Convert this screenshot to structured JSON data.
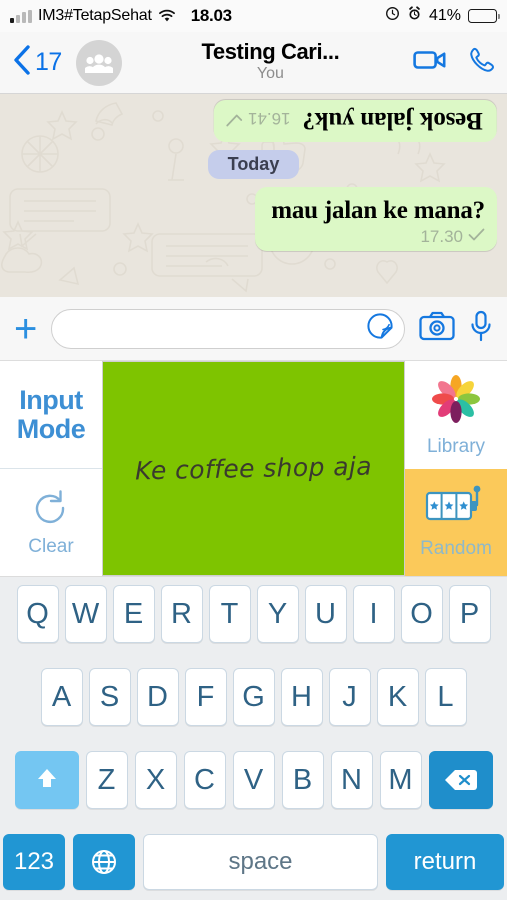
{
  "status_bar": {
    "carrier": "IM3#TetapSehat",
    "wifi_icon": "wifi-icon",
    "time": "18.03",
    "rotation_lock_icon": "rotation-lock-icon",
    "alarm_icon": "alarm-clock-icon",
    "battery_percent": "41%",
    "battery_level": 41
  },
  "navbar": {
    "back_label": "17",
    "back_icon": "chevron-left-icon",
    "avatar_icon": "group-avatar-icon",
    "title": "Testing Cari...",
    "subtitle": "You",
    "video_icon": "video-camera-icon",
    "call_icon": "phone-icon"
  },
  "chat": {
    "messages": [
      {
        "text": "Besok jalan yuk?",
        "time": "16.41",
        "status_icon": "single-check-icon",
        "flipped": true
      },
      {
        "text": "mau jalan ke mana?",
        "time": "17.30",
        "status_icon": "single-check-icon",
        "flipped": false
      }
    ],
    "day_divider": "Today",
    "bubble_color": "#DCF8C6",
    "background_color": "#E9E5DD"
  },
  "input_bar": {
    "plus_icon": "plus-icon",
    "plus_label": "+",
    "field_value": "",
    "field_placeholder": "",
    "sticker_icon": "sticker-icon",
    "camera_icon": "camera-icon",
    "mic_icon": "microphone-icon"
  },
  "handwriting_panel": {
    "input_mode_label": "Input\nMode",
    "input_mode_line1": "Input",
    "input_mode_line2": "Mode",
    "clear_icon": "refresh-icon",
    "clear_label": "Clear",
    "canvas_text": "Ke coffee shop aja",
    "canvas_color": "#7EC400",
    "library_icon": "flower-pinwheel-icon",
    "library_label": "Library",
    "random_icon": "slot-machine-icon",
    "random_label": "Random",
    "random_bg_color": "#FBC95A",
    "accent_color": "#3D8FD4"
  },
  "keyboard": {
    "row1": [
      "Q",
      "W",
      "E",
      "R",
      "T",
      "Y",
      "U",
      "I",
      "O",
      "P"
    ],
    "row2": [
      "A",
      "S",
      "D",
      "F",
      "G",
      "H",
      "J",
      "K",
      "L"
    ],
    "row3": [
      "Z",
      "X",
      "C",
      "V",
      "B",
      "N",
      "M"
    ],
    "shift_icon": "shift-arrow-icon",
    "backspace_icon": "backspace-icon",
    "numbers_label": "123",
    "globe_icon": "globe-icon",
    "space_label": "space",
    "return_label": "return",
    "key_text_color": "#2F6285",
    "accent_color": "#2196D3"
  }
}
